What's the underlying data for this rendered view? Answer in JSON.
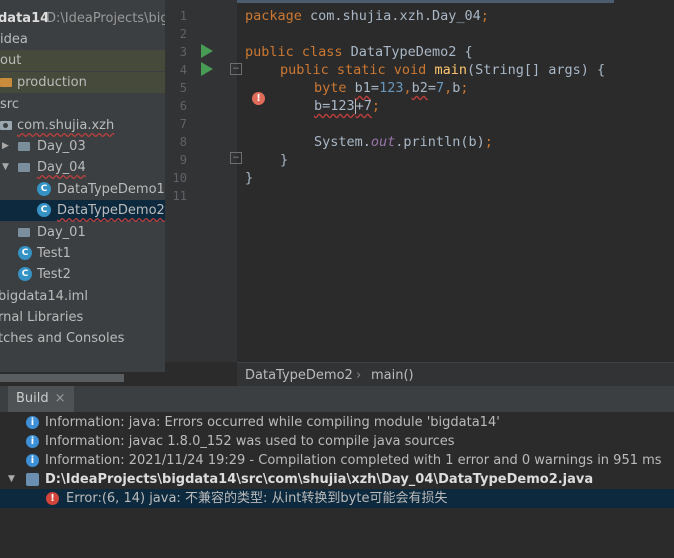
{
  "colors": {
    "accent": "#3592c4",
    "selection": "#0d293e",
    "error": "#d1453b",
    "info": "#3d8fd6",
    "run": "#499c54"
  },
  "project": {
    "items": [
      {
        "label": "data14",
        "suffix": "D:\\IdeaProjects\\big"
      },
      {
        "label": "idea"
      },
      {
        "label": "out"
      },
      {
        "label": "production"
      },
      {
        "label": "src"
      },
      {
        "label": "com.shujia.xzh"
      },
      {
        "label": "Day_03"
      },
      {
        "label": "Day_04"
      },
      {
        "label": "DataTypeDemo1"
      },
      {
        "label": "DataTypeDemo2"
      },
      {
        "label": "Day_01"
      },
      {
        "label": "Test1"
      },
      {
        "label": "Test2"
      },
      {
        "label": "bigdata14.iml"
      },
      {
        "label": "rnal Libraries"
      },
      {
        "label": "tches and Consoles"
      }
    ]
  },
  "editor": {
    "line_numbers": [
      "1",
      "2",
      "3",
      "4",
      "5",
      "6",
      "7",
      "8",
      "9",
      "10",
      "11"
    ],
    "l1": {
      "kw": "package",
      "rest": " com.shujia.xzh.Day_04",
      "semi": ";"
    },
    "l3": {
      "kw": "public class",
      "name": " DataTypeDemo2 ",
      "brace": "{"
    },
    "l4": {
      "kw": "public static void",
      "fn": "main",
      "args": "(String[] args) ",
      "brace": "{"
    },
    "l5": {
      "kw": "byte",
      "a": "b1",
      "eq1": "=",
      "n1": "123",
      "comma1": ",",
      "b": "b2",
      "eq2": "=",
      "n2": "7",
      "comma2": ",",
      "c": "b",
      "semi": ";"
    },
    "l6": {
      "pre": "b=123",
      "post": "+7",
      "semi": ";"
    },
    "l8": {
      "obj": "System.",
      "field": "out",
      "rest": ".println(b)",
      "semi": ";"
    },
    "l9": {
      "brace": "}"
    },
    "l10": {
      "brace": "}"
    }
  },
  "breadcrumb": {
    "file": "DataTypeDemo2",
    "sep": "›",
    "method": "main()"
  },
  "build": {
    "tab_label": "Build",
    "close": "×",
    "messages": [
      {
        "type": "info",
        "text": "Information: java: Errors occurred while compiling module 'bigdata14'"
      },
      {
        "type": "info",
        "text": "Information: javac 1.8.0_152 was used to compile java sources"
      },
      {
        "type": "info",
        "text": "Information: 2021/11/24 19:29 - Compilation completed with 1 error and 0 warnings in 951 ms"
      },
      {
        "type": "file",
        "text": "D:\\IdeaProjects\\bigdata14\\src\\com\\shujia\\xzh\\Day_04\\DataTypeDemo2.java"
      },
      {
        "type": "error",
        "text": "Error:(6, 14)  java: 不兼容的类型: 从int转换到byte可能会有损失"
      }
    ]
  }
}
